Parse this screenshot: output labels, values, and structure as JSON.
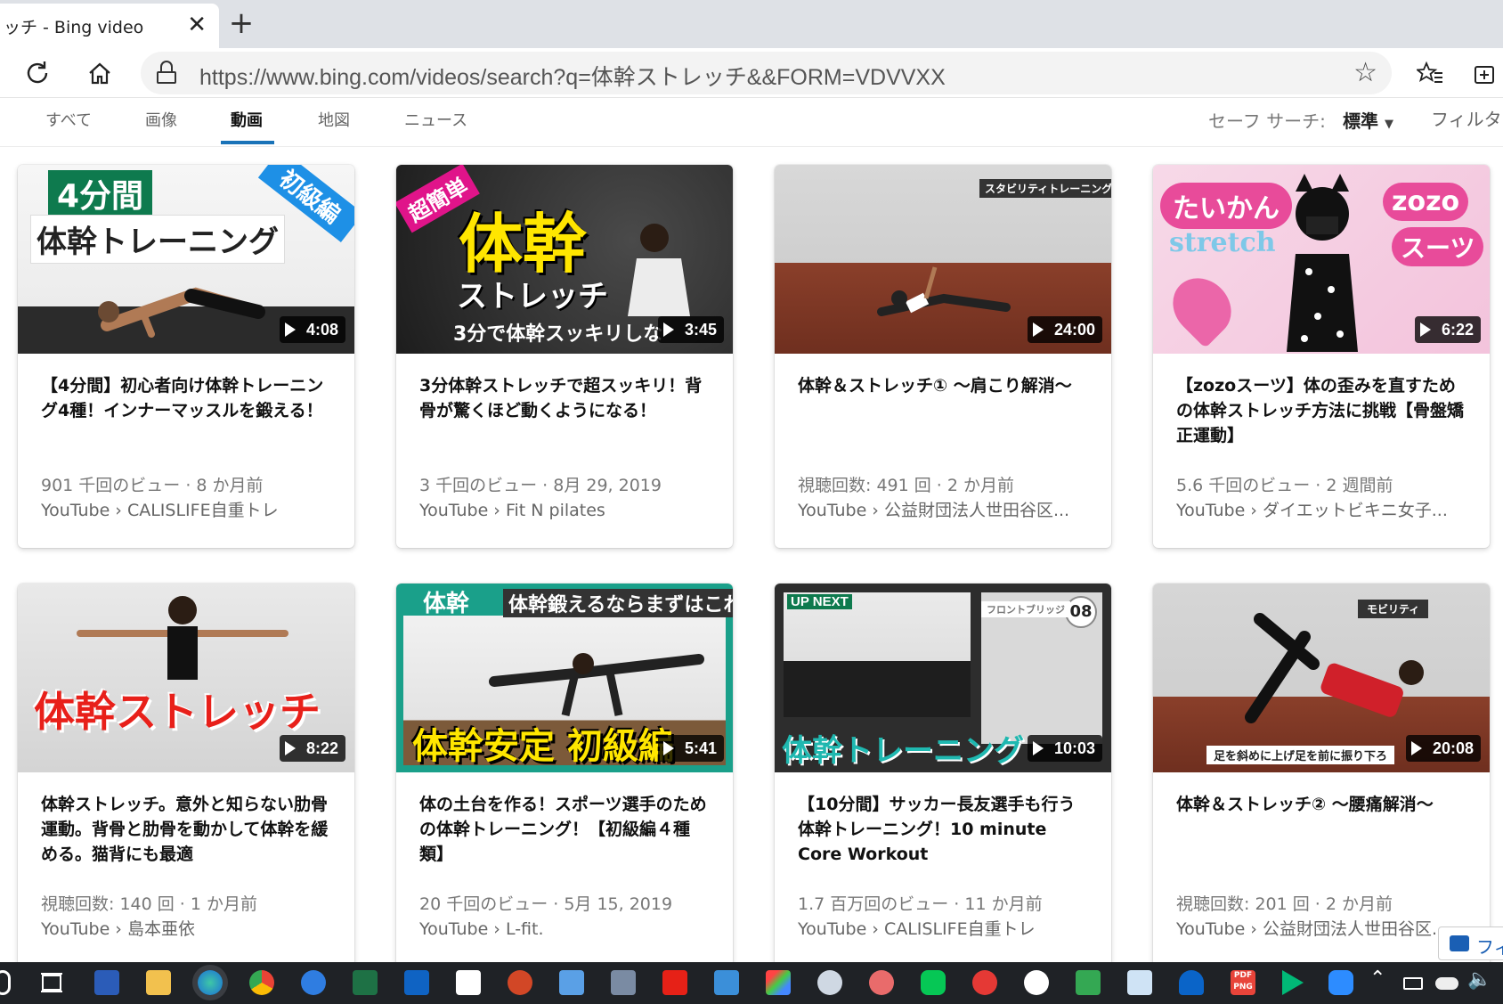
{
  "browser": {
    "tab_title": "ッチ - Bing video",
    "tab_close": "✕",
    "new_tab": "+",
    "url": "https://www.bing.com/videos/search?q=体幹ストレッチ&&FORM=VDVVXX"
  },
  "nav": {
    "items": [
      "すべて",
      "画像",
      "動画",
      "地図",
      "ニュース"
    ],
    "active": "動画",
    "safe_search_label": "セーフ サーチ:",
    "safe_search_value": "標準",
    "filter_label": "フィルタ"
  },
  "videos": [
    {
      "duration": "4:08",
      "thumb_text": [
        "4分間",
        "体幹トレーニング",
        "初級編"
      ],
      "title": "【4分間】初心者向け体幹トレーニング4種！インナーマッスルを鍛える！",
      "stats": "901 千回のビュー · 8 か月前",
      "source": "YouTube › CALISLIFE自重トレ"
    },
    {
      "duration": "3:45",
      "thumb_text": [
        "超簡単",
        "体幹",
        "ストレッチ",
        "3分で体幹スッキリしな"
      ],
      "title": "3分体幹ストレッチで超スッキリ！背骨が驚くほど動くようになる！",
      "stats": "3 千回のビュー · 8月 29, 2019",
      "source": "YouTube › Fit N pilates"
    },
    {
      "duration": "24:00",
      "thumb_text": [
        "スタビリティトレーニング"
      ],
      "title": "体幹＆ストレッチ① 〜肩こり解消〜",
      "stats": "視聴回数: 491 回 · 2 か月前",
      "source": "YouTube › 公益財団法人世田谷区..."
    },
    {
      "duration": "6:22",
      "thumb_text": [
        "たいかん",
        "stretch",
        "zozo",
        "スーツ"
      ],
      "title": "【zozoスーツ】体の歪みを直すための体幹ストレッチ方法に挑戦【骨盤矯正運動】",
      "stats": "5.6 千回のビュー · 2 週間前",
      "source": "YouTube › ダイエットビキニ女子..."
    },
    {
      "duration": "8:22",
      "thumb_text": [
        "体幹ストレッチ"
      ],
      "title": "体幹ストレッチ。意外と知らない肋骨運動。背骨と肋骨を動かして体幹を緩める。猫背にも最適",
      "stats": "視聴回数: 140 回 · 1 か月前",
      "source": "YouTube › 島本亜依"
    },
    {
      "duration": "5:41",
      "thumb_text": [
        "体幹",
        "体幹鍛えるならまずはこれ",
        "体幹安定 初級編"
      ],
      "title": "体の土台を作る！スポーツ選手のための体幹トレーニング！【初級編４種類】",
      "stats": "20 千回のビュー · 5月 15, 2019",
      "source": "YouTube › L-fit."
    },
    {
      "duration": "10:03",
      "thumb_text": [
        "UP NEXT",
        "08",
        "フロントブリッジ",
        "体幹トレーニング"
      ],
      "title": "【10分間】サッカー長友選手も行う体幹トレーニング！10 minute Core Workout",
      "stats": "1.7 百万回のビュー · 11 か月前",
      "source": "YouTube › CALISLIFE自重トレ"
    },
    {
      "duration": "20:08",
      "thumb_text": [
        "モビリティ",
        "足を斜めに上げ足を前に振り下ろ"
      ],
      "title": "体幹＆ストレッチ② 〜腰痛解消〜",
      "stats": "視聴回数: 201 回 · 2 か月前",
      "source": "YouTube › 公益財団法人世田谷区..."
    }
  ],
  "feedback_label": "フィ",
  "taskbar": {
    "icons": [
      "windows-icon",
      "task-view-icon",
      "word-icon",
      "file-explorer-icon",
      "edge-icon",
      "chrome-icon",
      "people-icon",
      "excel-icon",
      "outlook-icon",
      "amazon-icon",
      "powerpoint-icon",
      "news-icon",
      "computer-icon",
      "youtube-icon",
      "photos-icon",
      "paint-icon",
      "paint3d-icon",
      "snip-icon",
      "line-icon",
      "app-icon",
      "google-icon",
      "maps-icon",
      "mail-icon",
      "onedrive-icon",
      "pdf-png-icon",
      "play-store-icon",
      "zoom-icon"
    ],
    "tray_icons": [
      "chevron-up-icon",
      "battery-icon",
      "cloud-icon",
      "volume-icon"
    ],
    "pdf_label": "PDF PNG"
  },
  "colors": {
    "accent": "#1a73b8",
    "taskbar": "#1f2226"
  }
}
